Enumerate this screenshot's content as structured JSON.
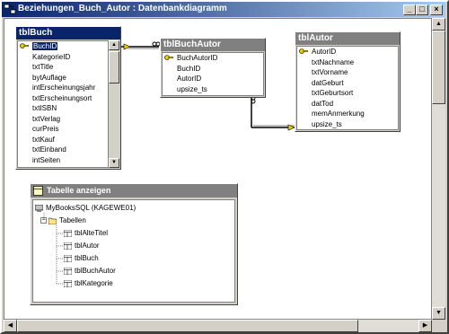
{
  "window": {
    "title": "Beziehungen_Buch_Autor : Datenbankdiagramm",
    "min_glyph": "_",
    "max_glyph": "□",
    "close_glyph": "×"
  },
  "tables": {
    "tblBuch": {
      "title": "tblBuch",
      "fields": [
        "BuchID",
        "KategorieID",
        "txtTitle",
        "bytAuflage",
        "intErscheinungsjahr",
        "txtErscheinungsort",
        "txtISBN",
        "txtVerlag",
        "curPreis",
        "txtKauf",
        "txtEinband",
        "intSeiten"
      ],
      "primary_key": "BuchID"
    },
    "tblBuchAutor": {
      "title": "tblBuchAutor",
      "fields": [
        "BuchAutorID",
        "BuchID",
        "AutorID",
        "upsize_ts"
      ],
      "primary_key": "BuchAutorID"
    },
    "tblAutor": {
      "title": "tblAutor",
      "fields": [
        "AutorID",
        "txtNachname",
        "txtVorname",
        "datGeburt",
        "txtGeburtsort",
        "datTod",
        "memAnmerkung",
        "upsize_ts"
      ],
      "primary_key": "AutorID"
    }
  },
  "show_tables": {
    "title": "Tabelle anzeigen",
    "server": "MyBooksSQL (KAGEWE01)",
    "folder": "Tabellen",
    "items": [
      "tblAlteTitel",
      "tblAutor",
      "tblBuch",
      "tblBuchAutor",
      "tblKategorie"
    ]
  },
  "colors": {
    "title_active": "#0a246a",
    "title_inactive": "#808080",
    "relation_key": "#e8d000"
  }
}
